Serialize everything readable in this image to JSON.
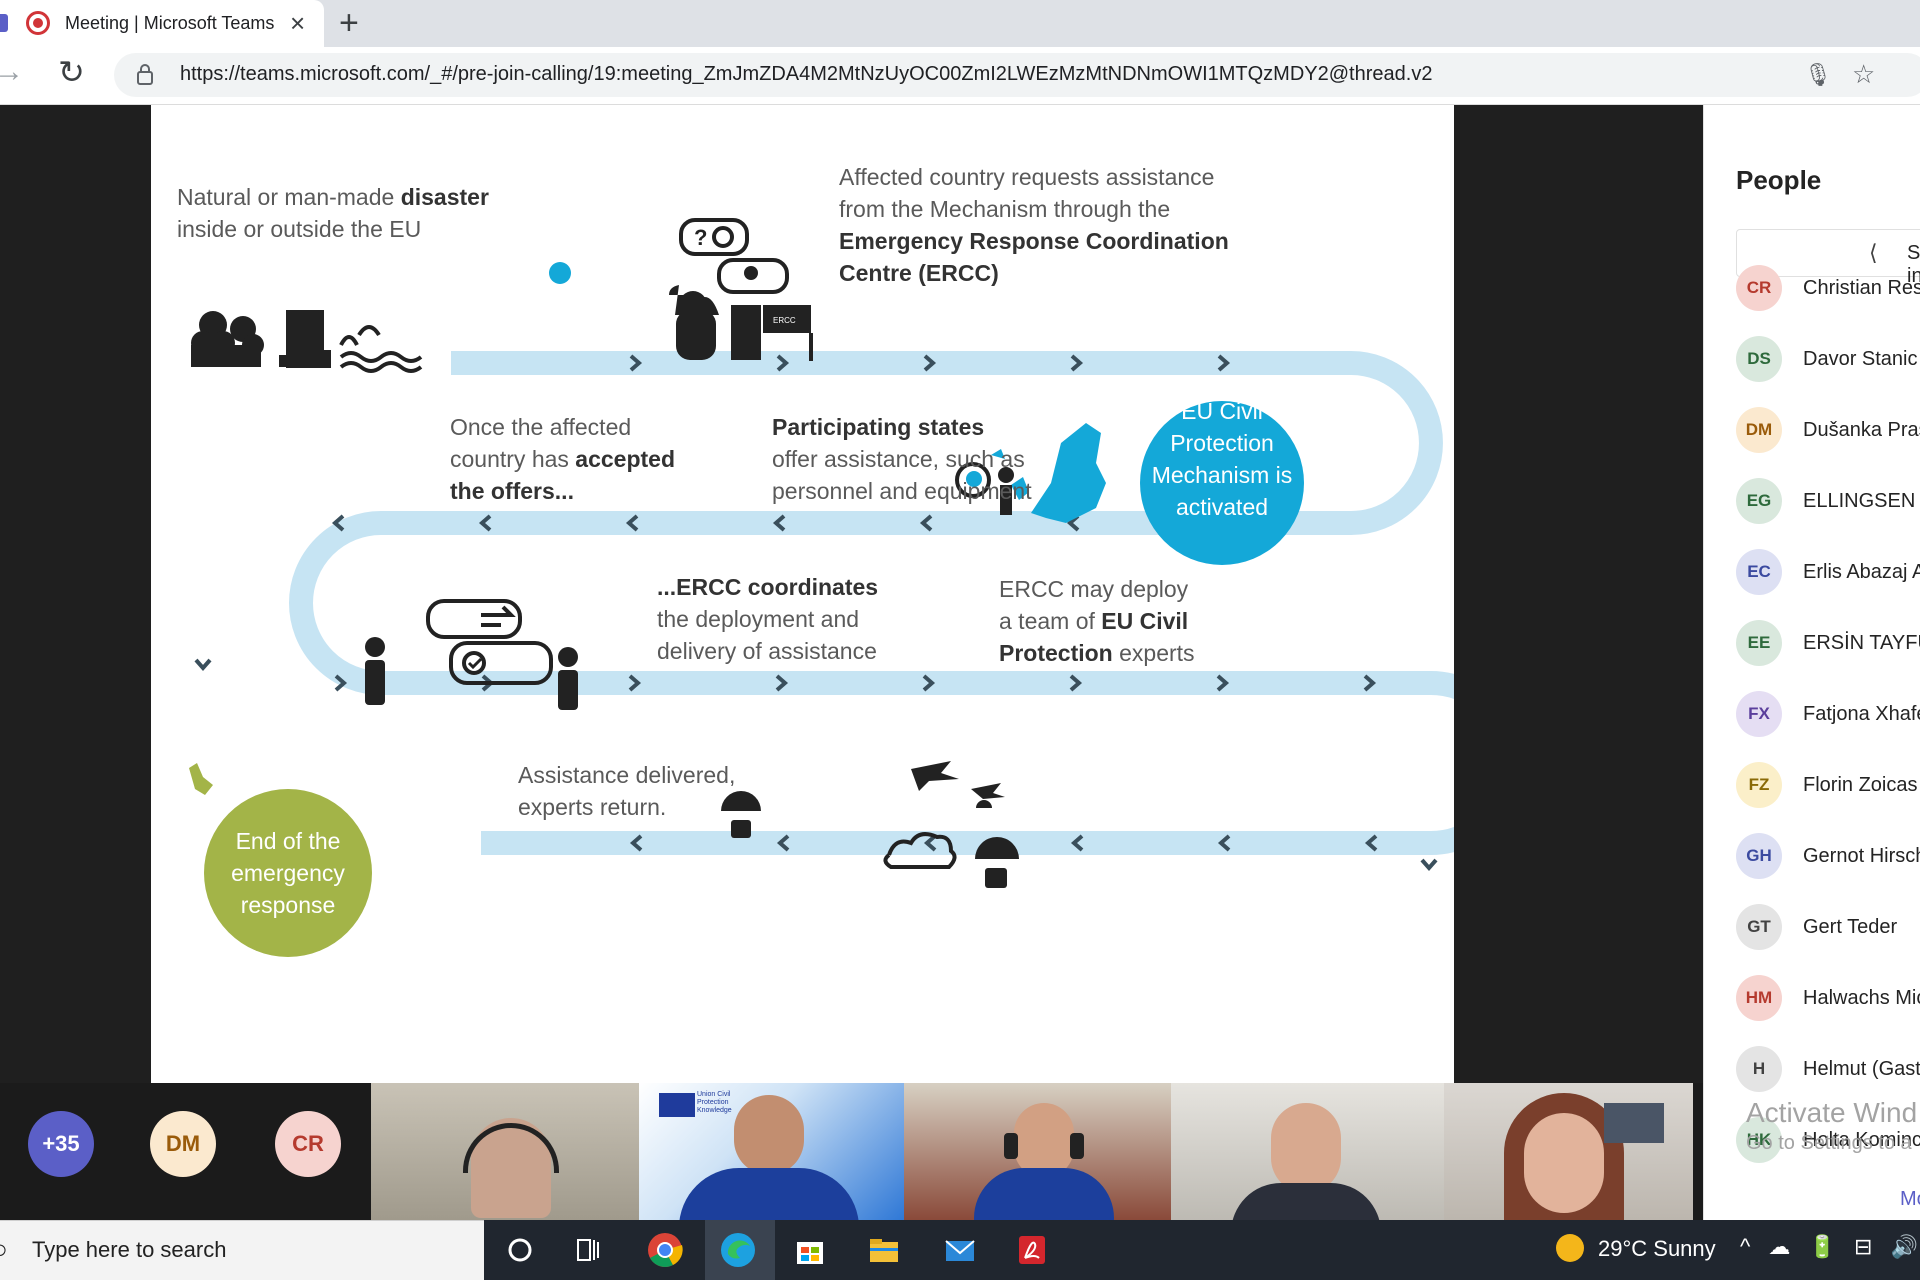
{
  "browser": {
    "tab_title": "Meeting | Microsoft Teams",
    "url": "https://teams.microsoft.com/_#/pre-join-calling/19:meeting_ZmJmZDA4M2MtNzUyOC00ZmI2LWEzMzMtNDNmOWI1MTQzMDY2@thread.v2"
  },
  "slide": {
    "step1": {
      "pre": "Natural or man-made ",
      "bold": "disaster",
      "line2": "inside or outside the EU"
    },
    "step2": {
      "l1": "Affected country requests assistance",
      "l2": "from the Mechanism through the",
      "b1": "Emergency Response Coordination",
      "b2": "Centre (ERCC)"
    },
    "ercc_sign": "ERCC",
    "activated": [
      "EU Civil",
      "Protection",
      "Mechanism is",
      "activated"
    ],
    "step3": {
      "bold": "Participating states",
      "l1": "offer assistance, such as",
      "l2": "personnel and equipment"
    },
    "step4": {
      "l1": "Once the affected",
      "l2pre": "country has ",
      "l2bold": "accepted",
      "l3bold": "the offers..."
    },
    "step5": {
      "bold": "...ERCC coordinates",
      "l1": "the deployment and",
      "l2": "delivery of assistance"
    },
    "step6": {
      "l1": "ERCC may deploy",
      "l2pre": "a team of ",
      "l2bold": "EU Civil",
      "l3bold": "Protection",
      "l3post": " experts"
    },
    "step7": {
      "l1": "Assistance delivered,",
      "l2": "experts return."
    },
    "end": [
      "End of the",
      "emergency",
      "response"
    ],
    "colors": {
      "track": "#c6e4f3",
      "chevron": "#3a4f5c",
      "blue_circle": "#14a8d8",
      "green_circle": "#a3b448",
      "icon": "#222222"
    }
  },
  "people_panel": {
    "heading": "People",
    "share_label": "Share invite",
    "participants": [
      {
        "initials": "CR",
        "name": "Christian Rese",
        "bg": "#f6d3cf",
        "fg": "#b53a2e"
      },
      {
        "initials": "DS",
        "name": "Davor Stanic",
        "bg": "#d9e8dd",
        "fg": "#2e6a3c"
      },
      {
        "initials": "DM",
        "name": "Dušanka Praš",
        "bg": "#fbe9cf",
        "fg": "#9a5b0a"
      },
      {
        "initials": "EG",
        "name": "ELLINGSEN G",
        "bg": "#d9e8dd",
        "fg": "#2e6a3c"
      },
      {
        "initials": "EC",
        "name": "Erlis Abazaj A",
        "bg": "#dde0f3",
        "fg": "#3b4aa0"
      },
      {
        "initials": "EE",
        "name": "ERSİN TAYFU",
        "bg": "#d9e8dd",
        "fg": "#2e6a3c"
      },
      {
        "initials": "FX",
        "name": "Fatjona Xhafe",
        "bg": "#e5def3",
        "fg": "#5b3f9c"
      },
      {
        "initials": "FZ",
        "name": "Florin Zoicas",
        "bg": "#fbefc9",
        "fg": "#8a6a07"
      },
      {
        "initials": "GH",
        "name": "Gernot Hirsch",
        "bg": "#dde0f3",
        "fg": "#3b4aa0"
      },
      {
        "initials": "GT",
        "name": "Gert Teder",
        "bg": "#e4e4e4",
        "fg": "#424242"
      },
      {
        "initials": "HM",
        "name": "Halwachs Mic",
        "bg": "#f6d3cf",
        "fg": "#b53a2e"
      },
      {
        "initials": "H",
        "name": "Helmut (Gast",
        "bg": "#e4e4e4",
        "fg": "#424242"
      },
      {
        "initials": "HK",
        "name": "Holta Kominc",
        "bg": "#d9e8dd",
        "fg": "#2e6a3c"
      }
    ],
    "watermark_l1": "Activate Wind",
    "watermark_l2": "Go to Settings to a",
    "more": "Mo"
  },
  "strip": {
    "overflow": "+35",
    "bubble1": "DM",
    "bubble2": "CR",
    "banner_text": "Union Civil Protection Knowledge"
  },
  "taskbar": {
    "search_placeholder": "Type here to search",
    "weather": "29°C  Sunny"
  }
}
